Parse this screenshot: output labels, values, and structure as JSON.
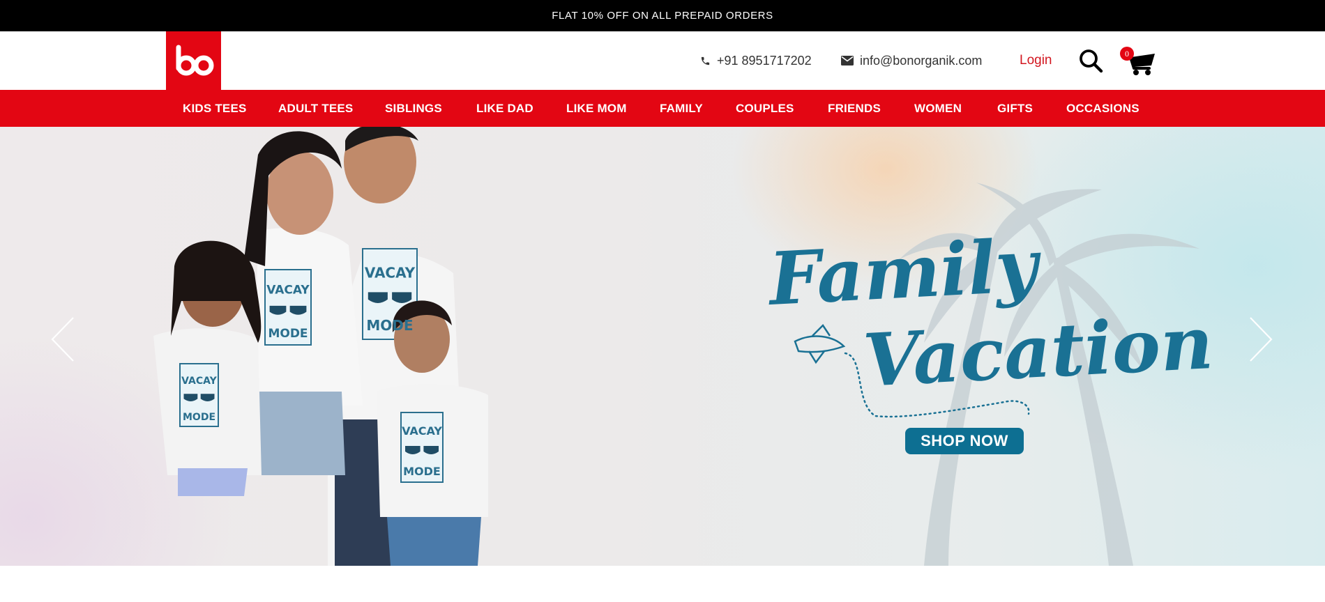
{
  "promo": {
    "text": "FLAT 10% OFF ON ALL PREPAID ORDERS"
  },
  "brand": {
    "logo_text": "bo",
    "accent": "#e30613"
  },
  "header": {
    "phone": "+91 8951717202",
    "email": "info@bonorganik.com",
    "login_label": "Login",
    "cart_count": "0",
    "icons": {
      "phone": "phone-icon",
      "email": "envelope-icon",
      "search": "search-icon",
      "cart": "cart-icon"
    }
  },
  "nav": {
    "items": [
      {
        "label": "KIDS TEES"
      },
      {
        "label": "ADULT TEES"
      },
      {
        "label": "SIBLINGS"
      },
      {
        "label": "LIKE DAD"
      },
      {
        "label": "LIKE MOM"
      },
      {
        "label": "FAMILY"
      },
      {
        "label": "COUPLES"
      },
      {
        "label": "FRIENDS"
      },
      {
        "label": "WOMEN"
      },
      {
        "label": "GIFTS"
      },
      {
        "label": "OCCASIONS"
      }
    ]
  },
  "hero": {
    "title_line1": "Family",
    "title_line2": "Vacation",
    "cta_label": "SHOP NOW",
    "tee_print": "VACAY MODE",
    "title_color": "#1a7194",
    "icons": {
      "prev": "chevron-left-icon",
      "next": "chevron-right-icon",
      "plane": "airplane-icon"
    }
  }
}
